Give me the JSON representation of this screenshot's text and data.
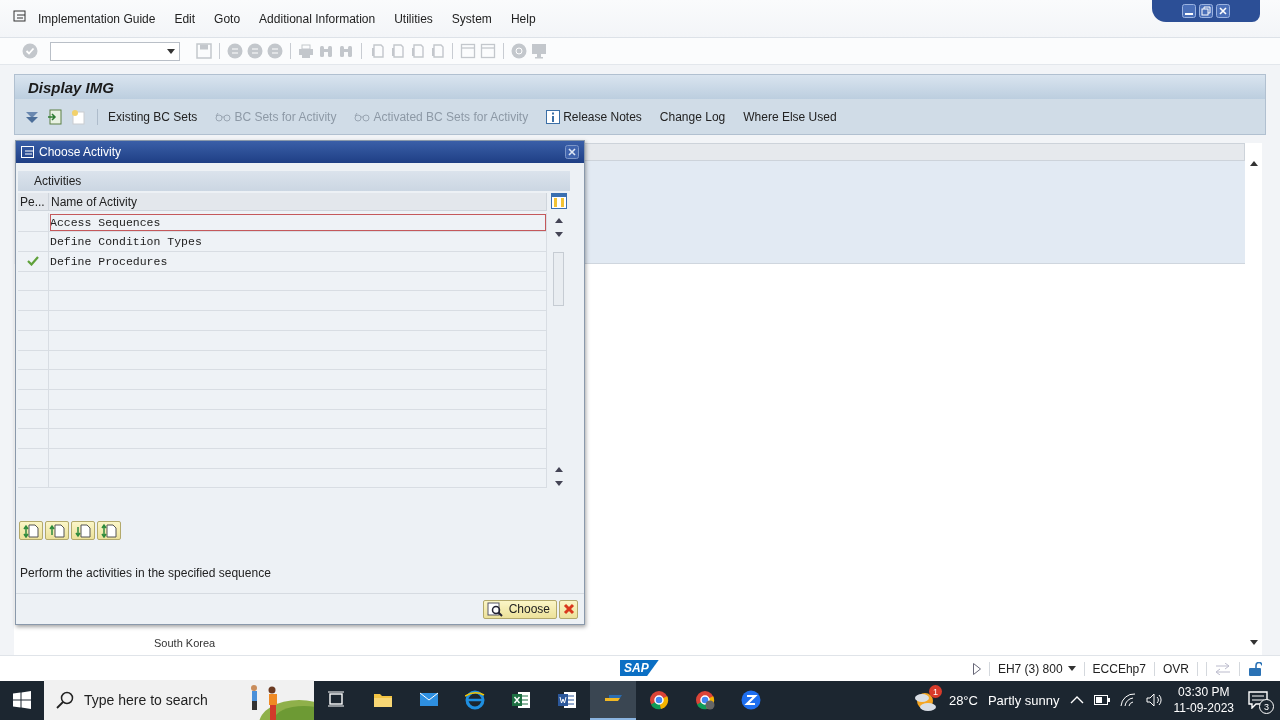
{
  "menu": [
    "Implementation Guide",
    "Edit",
    "Goto",
    "Additional Information",
    "Utilities",
    "System",
    "Help"
  ],
  "title": "Display IMG",
  "app_toolbar": [
    {
      "label": "Existing BC Sets",
      "disabled": false,
      "kind": "plain"
    },
    {
      "label": "BC Sets for Activity",
      "disabled": true,
      "kind": "glasses"
    },
    {
      "label": "Activated BC Sets for Activity",
      "disabled": true,
      "kind": "glasses"
    },
    {
      "label": "Release Notes",
      "disabled": false,
      "kind": "info"
    },
    {
      "label": "Change Log",
      "disabled": false,
      "kind": "plain"
    },
    {
      "label": "Where Else Used",
      "disabled": false,
      "kind": "plain"
    }
  ],
  "background_text": "South Korea",
  "dialog": {
    "title": "Choose Activity",
    "section": "Activities",
    "columns": [
      "Pe...",
      "Name of Activity"
    ],
    "rows": [
      {
        "name": "Access Sequences",
        "performed": false,
        "selected": true
      },
      {
        "name": "Define Condition Types",
        "performed": false,
        "selected": false
      },
      {
        "name": "Define Procedures",
        "performed": true,
        "selected": false
      }
    ],
    "hint": "Perform the activities in the specified sequence",
    "choose_button": "Choose"
  },
  "status_bar": {
    "logo_text": "SAP",
    "system": "EH7 (3) 800",
    "server": "ECCEhp7",
    "mode": "OVR"
  },
  "taskbar": {
    "search_placeholder": "Type here to search",
    "weather_badge": "1",
    "temperature": "28°C",
    "condition": "Partly sunny",
    "time": "03:30 PM",
    "date": "11-09-2023",
    "notification_count": "3"
  }
}
